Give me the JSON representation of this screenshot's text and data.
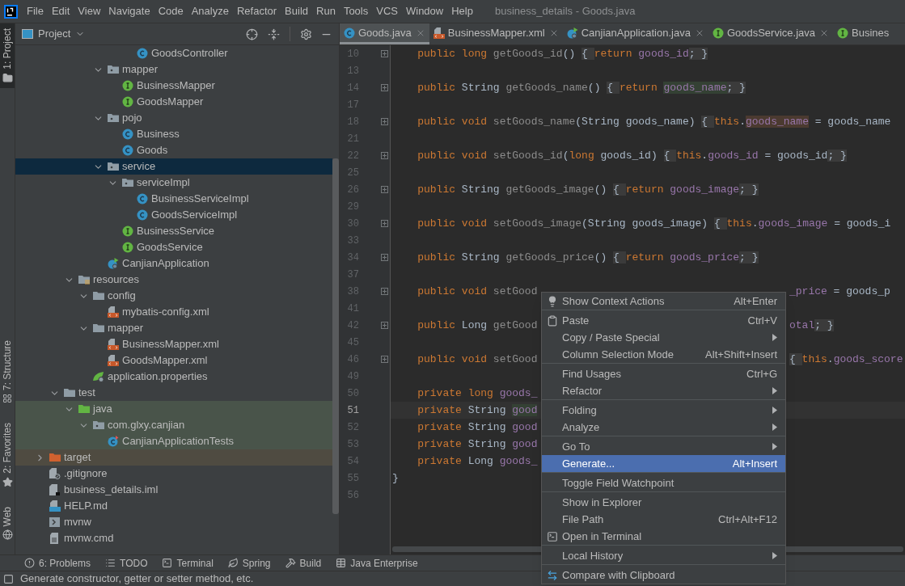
{
  "menu_bar": {
    "items": [
      "File",
      "Edit",
      "View",
      "Navigate",
      "Code",
      "Analyze",
      "Refactor",
      "Build",
      "Run",
      "Tools",
      "VCS",
      "Window",
      "Help"
    ],
    "title": "business_details - Goods.java"
  },
  "tool_strip": [
    {
      "label": "1: Project",
      "kind": "folder",
      "selected": true
    },
    {
      "label": "7: Structure",
      "kind": "structure",
      "selected": false
    },
    {
      "label": "2: Favorites",
      "kind": "star",
      "selected": false
    },
    {
      "label": "Web",
      "kind": "globe",
      "selected": false
    }
  ],
  "project_panel": {
    "title": "Project",
    "tree": [
      {
        "children": [
          {
            "children": [
              {
                "children": [
                  {
                    "children": [
                      {
                        "children": [
                          {
                            "children": [
                              {
                                "label": "GoodsController",
                                "kind": "class",
                                "selected": false
                              }
                            ]
                          }
                        ]
                      },
                      {
                        "label": "mapper",
                        "kind": "package",
                        "expanded": true,
                        "selected": false,
                        "children": [
                          {
                            "label": "BusinessMapper",
                            "kind": "interface",
                            "selected": false
                          },
                          {
                            "label": "GoodsMapper",
                            "kind": "interface",
                            "selected": false
                          }
                        ]
                      },
                      {
                        "label": "pojo",
                        "kind": "package",
                        "expanded": true,
                        "selected": false,
                        "children": [
                          {
                            "label": "Business",
                            "kind": "class",
                            "selected": false
                          },
                          {
                            "label": "Goods",
                            "kind": "class",
                            "selected": false
                          }
                        ]
                      },
                      {
                        "label": "service",
                        "kind": "package",
                        "expanded": true,
                        "selected": true,
                        "children": [
                          {
                            "label": "serviceImpl",
                            "kind": "package",
                            "expanded": true,
                            "selected": false,
                            "children": [
                              {
                                "label": "BusinessServiceImpl",
                                "kind": "class",
                                "selected": false
                              },
                              {
                                "label": "GoodsServiceImpl",
                                "kind": "class",
                                "selected": false
                              }
                            ]
                          },
                          {
                            "label": "BusinessService",
                            "kind": "interface",
                            "selected": false
                          },
                          {
                            "label": "GoodsService",
                            "kind": "interface",
                            "selected": false
                          }
                        ]
                      },
                      {
                        "label": "CanjianApplication",
                        "kind": "spring-class",
                        "selected": false
                      }
                    ]
                  }
                ]
              },
              {
                "label": "resources",
                "kind": "resources",
                "expanded": true,
                "selected": false,
                "children": [
                  {
                    "label": "config",
                    "kind": "folder",
                    "expanded": true,
                    "selected": false,
                    "children": [
                      {
                        "label": "mybatis-config.xml",
                        "kind": "xml",
                        "selected": false
                      }
                    ]
                  },
                  {
                    "label": "mapper",
                    "kind": "folder",
                    "expanded": true,
                    "selected": false,
                    "children": [
                      {
                        "label": "BusinessMapper.xml",
                        "kind": "xml",
                        "selected": false
                      },
                      {
                        "label": "GoodsMapper.xml",
                        "kind": "xml",
                        "selected": false
                      }
                    ]
                  },
                  {
                    "label": "application.properties",
                    "kind": "properties",
                    "selected": false
                  }
                ]
              }
            ]
          },
          {
            "label": "test",
            "kind": "folder",
            "expanded": true,
            "selected": false,
            "children": [
              {
                "label": "java",
                "kind": "test-root",
                "expanded": true,
                "selected": false,
                "test_source": true,
                "children": [
                  {
                    "label": "com.glxy.canjian",
                    "kind": "package",
                    "expanded": true,
                    "selected": false,
                    "test_source": true,
                    "children": [
                      {
                        "label": "CanjianApplicationTests",
                        "kind": "test-class",
                        "selected": false,
                        "test_source": true
                      }
                    ]
                  }
                ]
              }
            ]
          }
        ]
      },
      {
        "label": "target",
        "kind": "excluded",
        "expanded": false,
        "selected": false,
        "excluded": true
      },
      {
        "label": ".gitignore",
        "kind": "ignore",
        "selected": false
      },
      {
        "label": "business_details.iml",
        "kind": "iml",
        "selected": false
      },
      {
        "label": "HELP.md",
        "kind": "markdown",
        "selected": false
      },
      {
        "label": "mvnw",
        "kind": "script",
        "selected": false
      },
      {
        "label": "mvnw.cmd",
        "kind": "text-file",
        "selected": false
      }
    ]
  },
  "editor": {
    "tabs": [
      {
        "label": "Goods.java",
        "kind": "class",
        "selected": true,
        "closable": true
      },
      {
        "label": "BusinessMapper.xml",
        "kind": "xml",
        "selected": false,
        "closable": true
      },
      {
        "label": "CanjianApplication.java",
        "kind": "spring-class",
        "selected": false,
        "closable": true
      },
      {
        "label": "GoodsService.java",
        "kind": "interface",
        "selected": false,
        "closable": true
      },
      {
        "label": "Busines",
        "kind": "interface",
        "selected": false,
        "closable": false
      }
    ],
    "lines": [
      {
        "number": "10",
        "folded": true,
        "current": false,
        "tokens": [
          {
            "text": "    public ",
            "kind": "kw"
          },
          {
            "text": "long ",
            "kind": "kw"
          },
          {
            "text": "getGoods_id",
            "kind": "fn"
          },
          {
            "text": "() ",
            "kind": "plain"
          },
          {
            "text": "{ ",
            "kind": "fold"
          },
          {
            "text": "return ",
            "kind": "kw"
          },
          {
            "text": "goods_id",
            "kind": "field"
          },
          {
            "text": "; }",
            "kind": "fold"
          }
        ]
      },
      {
        "number": "13",
        "folded": false,
        "current": false
      },
      {
        "number": "14",
        "folded": true,
        "current": false,
        "tokens": [
          {
            "text": "    public ",
            "kind": "kw"
          },
          {
            "text": "String ",
            "kind": "plain"
          },
          {
            "text": "getGoods_name",
            "kind": "fn"
          },
          {
            "text": "() ",
            "kind": "plain"
          },
          {
            "text": "{ ",
            "kind": "fold"
          },
          {
            "text": "return ",
            "kind": "kw"
          },
          {
            "text": "goods_name",
            "kind": "field-read"
          },
          {
            "text": "; }",
            "kind": "fold"
          }
        ]
      },
      {
        "number": "17",
        "folded": false,
        "current": false
      },
      {
        "number": "18",
        "folded": true,
        "current": false,
        "tokens": [
          {
            "text": "    public ",
            "kind": "kw"
          },
          {
            "text": "void ",
            "kind": "kw"
          },
          {
            "text": "setGoods_name",
            "kind": "fn"
          },
          {
            "text": "(String goods_name) ",
            "kind": "plain"
          },
          {
            "text": "{ ",
            "kind": "fold"
          },
          {
            "text": "this",
            "kind": "kw"
          },
          {
            "text": ".",
            "kind": "plain"
          },
          {
            "text": "goods_name",
            "kind": "field-write"
          },
          {
            "text": " = goods_name",
            "kind": "plain"
          }
        ]
      },
      {
        "number": "21",
        "folded": false,
        "current": false
      },
      {
        "number": "22",
        "folded": true,
        "current": false,
        "tokens": [
          {
            "text": "    public ",
            "kind": "kw"
          },
          {
            "text": "void ",
            "kind": "kw"
          },
          {
            "text": "setGoods_id",
            "kind": "fn"
          },
          {
            "text": "(",
            "kind": "plain"
          },
          {
            "text": "long ",
            "kind": "kw"
          },
          {
            "text": "goods_id) ",
            "kind": "plain"
          },
          {
            "text": "{ ",
            "kind": "fold"
          },
          {
            "text": "this",
            "kind": "kw"
          },
          {
            "text": ".",
            "kind": "plain"
          },
          {
            "text": "goods_id",
            "kind": "field"
          },
          {
            "text": " = goods_id",
            "kind": "plain"
          },
          {
            "text": "; }",
            "kind": "fold"
          }
        ]
      },
      {
        "number": "25",
        "folded": false,
        "current": false
      },
      {
        "number": "26",
        "folded": true,
        "current": false,
        "tokens": [
          {
            "text": "    public ",
            "kind": "kw"
          },
          {
            "text": "String ",
            "kind": "plain"
          },
          {
            "text": "getGoods_image",
            "kind": "fn"
          },
          {
            "text": "() ",
            "kind": "plain"
          },
          {
            "text": "{ ",
            "kind": "fold"
          },
          {
            "text": "return ",
            "kind": "kw"
          },
          {
            "text": "goods_image",
            "kind": "field"
          },
          {
            "text": "; }",
            "kind": "fold"
          }
        ]
      },
      {
        "number": "29",
        "folded": false,
        "current": false
      },
      {
        "number": "30",
        "folded": true,
        "current": false,
        "tokens": [
          {
            "text": "    public ",
            "kind": "kw"
          },
          {
            "text": "void ",
            "kind": "kw"
          },
          {
            "text": "setGoods_image",
            "kind": "fn"
          },
          {
            "text": "(String goods_image) ",
            "kind": "plain"
          },
          {
            "text": "{ ",
            "kind": "fold"
          },
          {
            "text": "this",
            "kind": "kw"
          },
          {
            "text": ".",
            "kind": "plain"
          },
          {
            "text": "goods_image",
            "kind": "field"
          },
          {
            "text": " = goods_i",
            "kind": "plain"
          }
        ]
      },
      {
        "number": "33",
        "folded": false,
        "current": false
      },
      {
        "number": "34",
        "folded": true,
        "current": false,
        "tokens": [
          {
            "text": "    public ",
            "kind": "kw"
          },
          {
            "text": "String ",
            "kind": "plain"
          },
          {
            "text": "getGoods_price",
            "kind": "fn"
          },
          {
            "text": "() ",
            "kind": "plain"
          },
          {
            "text": "{ ",
            "kind": "fold"
          },
          {
            "text": "return ",
            "kind": "kw"
          },
          {
            "text": "goods_price",
            "kind": "field"
          },
          {
            "text": "; }",
            "kind": "fold"
          }
        ]
      },
      {
        "number": "37",
        "folded": false,
        "current": false
      },
      {
        "number": "38",
        "folded": true,
        "current": false,
        "tokens": [
          {
            "text": "    public ",
            "kind": "kw"
          },
          {
            "text": "void ",
            "kind": "kw"
          },
          {
            "text": "setGood",
            "kind": "fn"
          }
        ],
        "tail": [
          {
            "text": "_price",
            "kind": "field"
          },
          {
            "text": " = goods_p",
            "kind": "plain"
          }
        ]
      },
      {
        "number": "41",
        "folded": false,
        "current": false
      },
      {
        "number": "42",
        "folded": true,
        "current": false,
        "tokens": [
          {
            "text": "    public ",
            "kind": "kw"
          },
          {
            "text": "Long ",
            "kind": "plain"
          },
          {
            "text": "getGood",
            "kind": "fn"
          }
        ],
        "tail": [
          {
            "text": "otal",
            "kind": "field"
          },
          {
            "text": "; }",
            "kind": "fold"
          }
        ]
      },
      {
        "number": "45",
        "folded": false,
        "current": false
      },
      {
        "number": "46",
        "folded": true,
        "current": false,
        "tokens": [
          {
            "text": "    public ",
            "kind": "kw"
          },
          {
            "text": "void ",
            "kind": "kw"
          },
          {
            "text": "setGood",
            "kind": "fn"
          }
        ],
        "tail": [
          {
            "text": "{ ",
            "kind": "fold"
          },
          {
            "text": "this",
            "kind": "kw"
          },
          {
            "text": ".",
            "kind": "plain"
          },
          {
            "text": "goods_score",
            "kind": "field"
          }
        ]
      },
      {
        "number": "49",
        "folded": false,
        "current": false
      },
      {
        "number": "50",
        "folded": false,
        "current": false,
        "tokens": [
          {
            "text": "    private ",
            "kind": "kw"
          },
          {
            "text": "long ",
            "kind": "kw"
          },
          {
            "text": "goods_",
            "kind": "field"
          }
        ]
      },
      {
        "number": "51",
        "folded": false,
        "current": true,
        "tokens": [
          {
            "text": "    private ",
            "kind": "kw"
          },
          {
            "text": "String ",
            "kind": "plain"
          },
          {
            "text": "good",
            "kind": "field-read"
          }
        ]
      },
      {
        "number": "52",
        "folded": false,
        "current": false,
        "tokens": [
          {
            "text": "    private ",
            "kind": "kw"
          },
          {
            "text": "String ",
            "kind": "plain"
          },
          {
            "text": "good",
            "kind": "field"
          }
        ]
      },
      {
        "number": "53",
        "folded": false,
        "current": false,
        "tokens": [
          {
            "text": "    private ",
            "kind": "kw"
          },
          {
            "text": "String ",
            "kind": "plain"
          },
          {
            "text": "good",
            "kind": "field"
          }
        ]
      },
      {
        "number": "54",
        "folded": false,
        "current": false,
        "tokens": [
          {
            "text": "    private ",
            "kind": "kw"
          },
          {
            "text": "Long ",
            "kind": "plain"
          },
          {
            "text": "goods_",
            "kind": "field"
          }
        ]
      },
      {
        "number": "55",
        "folded": false,
        "current": false,
        "tokens": [
          {
            "text": "}",
            "kind": "plain"
          }
        ]
      },
      {
        "number": "56",
        "folded": false,
        "current": false
      }
    ]
  },
  "context_menu": {
    "groups": [
      [
        {
          "label": "Show Context Actions",
          "shortcut": "Alt+Enter",
          "kind": "bulb",
          "submenu": false,
          "selected": false
        }
      ],
      [
        {
          "label": "Paste",
          "shortcut": "Ctrl+V",
          "kind": "clipboard",
          "submenu": false,
          "selected": false
        },
        {
          "label": "Copy / Paste Special",
          "submenu": true,
          "selected": false
        },
        {
          "label": "Column Selection Mode",
          "shortcut": "Alt+Shift+Insert",
          "submenu": false,
          "selected": false
        }
      ],
      [
        {
          "label": "Find Usages",
          "shortcut": "Ctrl+G",
          "submenu": false,
          "selected": false
        },
        {
          "label": "Refactor",
          "submenu": true,
          "selected": false
        }
      ],
      [
        {
          "label": "Folding",
          "submenu": true,
          "selected": false
        },
        {
          "label": "Analyze",
          "submenu": true,
          "selected": false
        }
      ],
      [
        {
          "label": "Go To",
          "submenu": true,
          "selected": false
        },
        {
          "label": "Generate...",
          "shortcut": "Alt+Insert",
          "submenu": false,
          "selected": true
        }
      ],
      [
        {
          "label": "Toggle Field Watchpoint",
          "submenu": false,
          "selected": false
        }
      ],
      [
        {
          "label": "Show in Explorer",
          "submenu": false,
          "selected": false
        },
        {
          "label": "File Path",
          "shortcut": "Ctrl+Alt+F12",
          "submenu": false,
          "selected": false
        },
        {
          "label": "Open in Terminal",
          "kind": "terminal",
          "submenu": false,
          "selected": false
        }
      ],
      [
        {
          "label": "Local History",
          "submenu": true,
          "selected": false
        }
      ],
      [
        {
          "label": "Compare with Clipboard",
          "kind": "compare",
          "submenu": false,
          "selected": false
        }
      ]
    ]
  },
  "bottom_tools": [
    {
      "label": "6: Problems",
      "kind": "problems"
    },
    {
      "label": "TODO",
      "kind": "todo"
    },
    {
      "label": "Terminal",
      "kind": "terminal"
    },
    {
      "label": "Spring",
      "kind": "spring"
    },
    {
      "label": "Build",
      "kind": "build"
    },
    {
      "label": "Java Enterprise",
      "kind": "enterprise"
    }
  ],
  "status_bar": {
    "text": "Generate constructor, getter or setter method, etc."
  }
}
